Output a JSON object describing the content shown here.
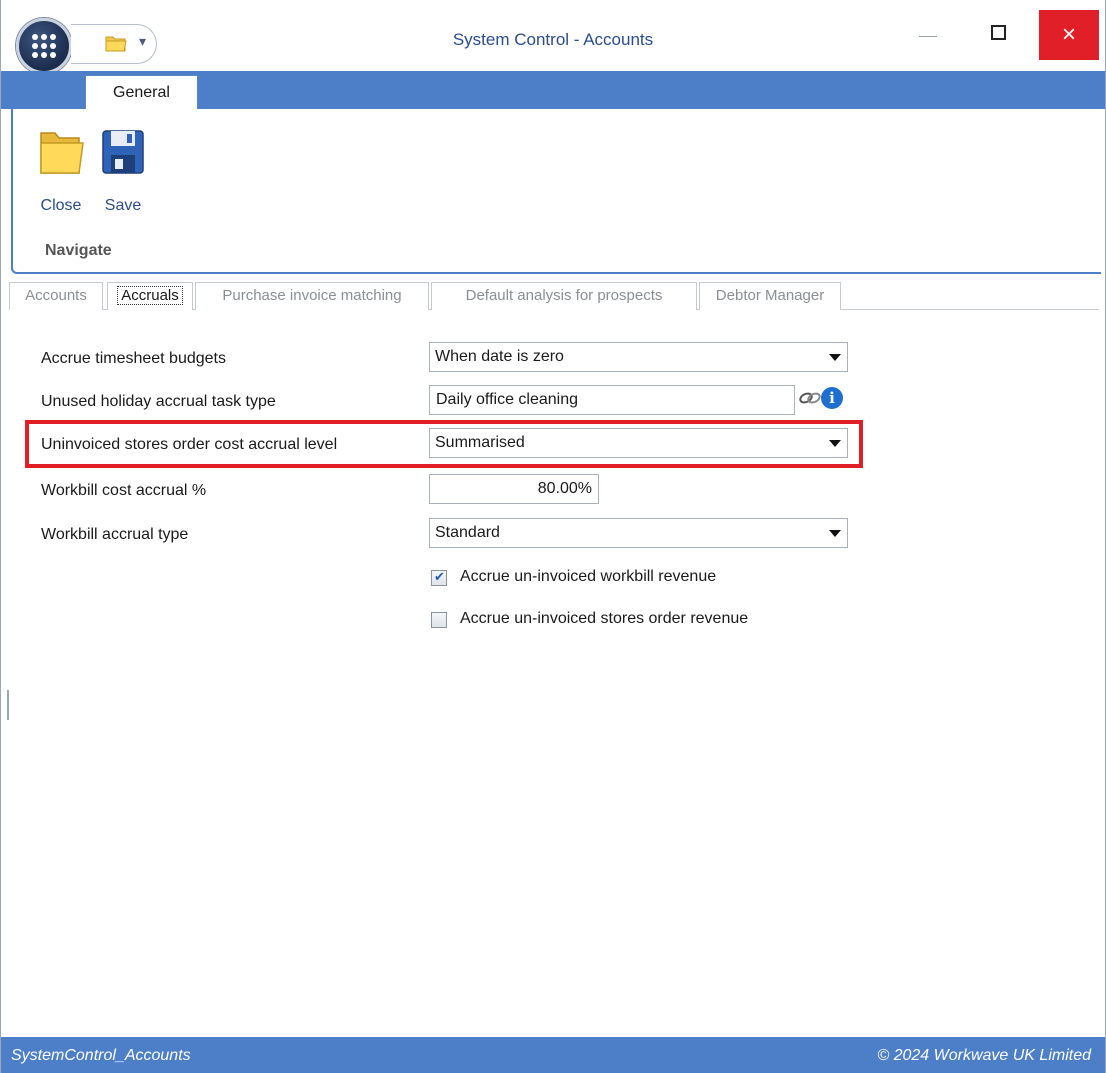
{
  "window": {
    "title": "System Control - Accounts",
    "minimize_label": "—",
    "close_label": "×",
    "qat_arrow": "▾"
  },
  "ribbon": {
    "tab_label": "General",
    "close_label": "Close",
    "save_label": "Save",
    "group_label": "Navigate"
  },
  "tabs": [
    {
      "label": "Accounts",
      "selected": false
    },
    {
      "label": "Accruals",
      "selected": true
    },
    {
      "label": "Purchase invoice matching",
      "selected": false
    },
    {
      "label": "Default analysis for prospects",
      "selected": false
    },
    {
      "label": "Debtor Manager",
      "selected": false
    }
  ],
  "form": {
    "accrue_timesheet_budgets": {
      "label": "Accrue timesheet budgets",
      "value": "When date is zero"
    },
    "unused_holiday_task_type": {
      "label": "Unused holiday accrual task type",
      "value": "Daily office cleaning",
      "info_glyph": "i"
    },
    "uninvoiced_stores_level": {
      "label": "Uninvoiced stores order cost accrual level",
      "value": "Summarised"
    },
    "workbill_cost_accrual_pct": {
      "label": "Workbill cost accrual %",
      "value": "80.00%"
    },
    "workbill_accrual_type": {
      "label": "Workbill accrual type",
      "value": "Standard"
    },
    "accrue_workbill_revenue": {
      "label": "Accrue un-invoiced workbill revenue",
      "checked": true
    },
    "accrue_stores_revenue": {
      "label": "Accrue un-invoiced stores order revenue",
      "checked": false
    }
  },
  "status": {
    "left": "SystemControl_Accounts",
    "right": "© 2024 Workwave UK Limited"
  },
  "colors": {
    "accent_blue": "#4c7fc7",
    "title_text": "#2a4c8e",
    "close_red": "#e11f28",
    "highlight_red": "#e11f28"
  },
  "icons": [
    "app-menu-icon",
    "folder-icon",
    "save-disk-icon",
    "lookup-link-icon",
    "info-icon",
    "dropdown-arrow-icon"
  ]
}
